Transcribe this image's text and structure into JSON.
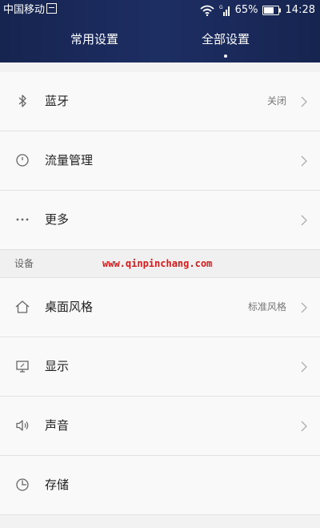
{
  "status_bar": {
    "carrier": "中国移动",
    "signal_label": "G",
    "battery_percent": "65%",
    "time": "14:28"
  },
  "tabs": [
    {
      "label": "常用设置",
      "active": false
    },
    {
      "label": "全部设置",
      "active": true
    }
  ],
  "list": {
    "bluetooth": {
      "label": "蓝牙",
      "value": "关闭",
      "icon": "bluetooth-icon"
    },
    "data_usage": {
      "label": "流量管理",
      "icon": "data-usage-icon"
    },
    "more": {
      "label": "更多",
      "icon": "more-dots-icon"
    },
    "section_device": {
      "label": "设备"
    },
    "watermark": "www.qinpinchang.com",
    "home_style": {
      "label": "桌面风格",
      "value": "标准风格",
      "icon": "home-icon"
    },
    "display": {
      "label": "显示",
      "icon": "display-icon"
    },
    "sound": {
      "label": "声音",
      "icon": "speaker-icon"
    },
    "storage": {
      "label": "存储",
      "icon": "storage-icon"
    }
  },
  "colors": {
    "header_bg": "#1a2858",
    "row_bg": "#f9f9f9",
    "divider": "#e2e2e2",
    "watermark": "#d41b1b"
  }
}
